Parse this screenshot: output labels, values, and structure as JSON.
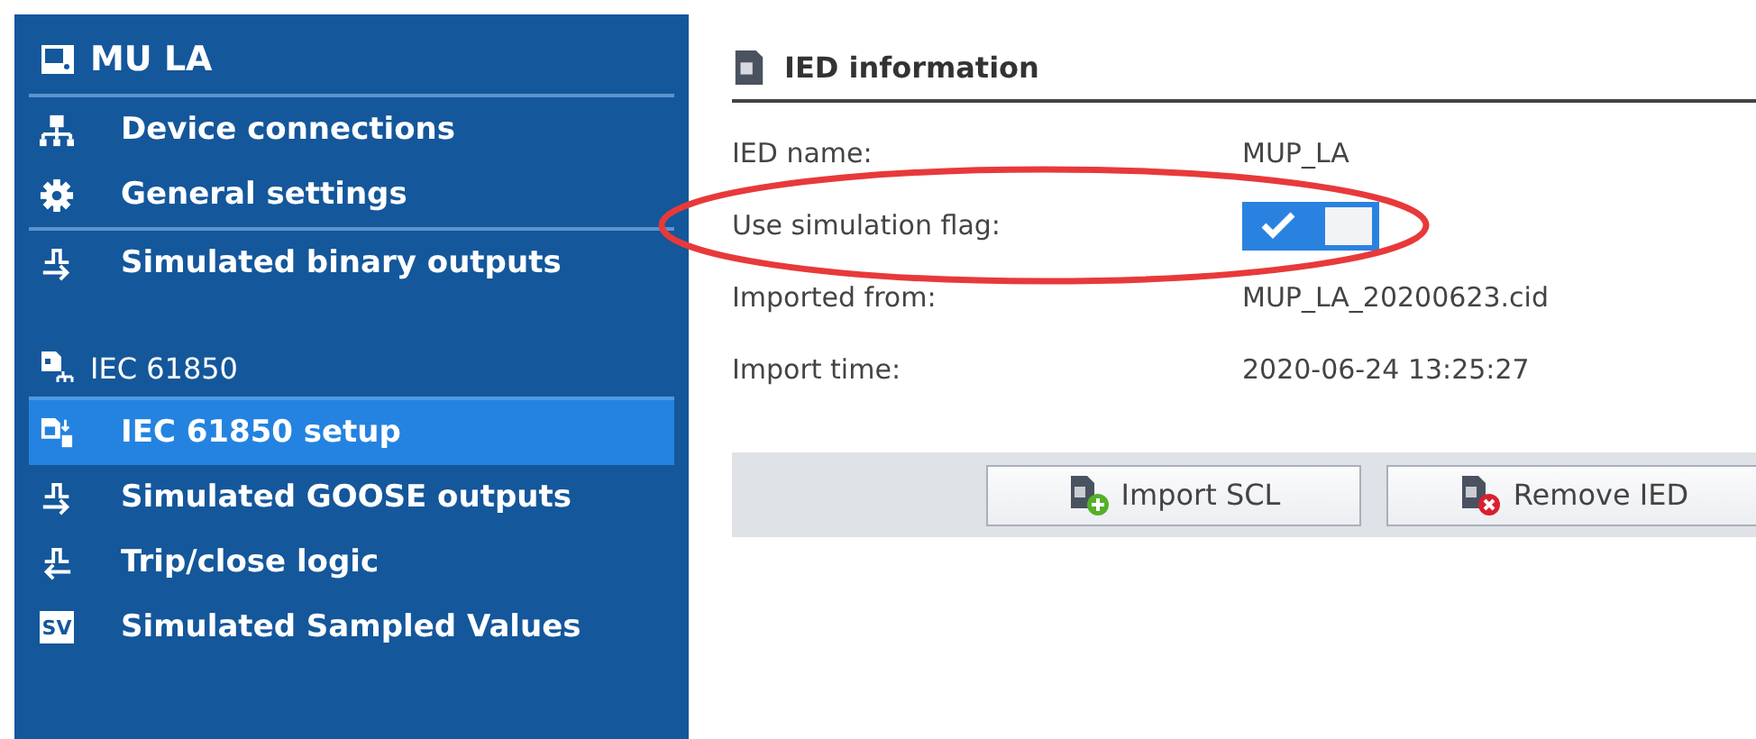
{
  "sidebar": {
    "sections": [
      {
        "title": "MU LA",
        "kind": "device",
        "items": [
          {
            "label": "Device connections",
            "kind": "network",
            "selected": false
          },
          {
            "label": "General settings",
            "kind": "gear",
            "selected": false
          },
          {
            "label": "Simulated binary outputs",
            "kind": "out",
            "selected": false
          }
        ]
      },
      {
        "title": "IEC 61850",
        "kind": "iec",
        "items": [
          {
            "label": "IEC 61850 setup",
            "kind": "setup",
            "selected": true
          },
          {
            "label": "Simulated GOOSE outputs",
            "kind": "out",
            "selected": false
          },
          {
            "label": "Trip/close logic",
            "kind": "in",
            "selected": false
          },
          {
            "label": "Simulated Sampled Values",
            "kind": "sv",
            "icon_text": "SV",
            "selected": false
          }
        ]
      }
    ]
  },
  "panel": {
    "title": "IED information",
    "rows": [
      {
        "label": "IED name:",
        "kind": "text",
        "value": "MUP_LA",
        "highlighted": false
      },
      {
        "label": "Use simulation flag:",
        "kind": "toggle",
        "on": true,
        "highlighted": true
      },
      {
        "label": "Imported from:",
        "kind": "text",
        "value": "MUP_LA_20200623.cid",
        "highlighted": false
      },
      {
        "label": "Import time:",
        "kind": "text",
        "value": "2020-06-24 13:25:27",
        "highlighted": false
      }
    ],
    "buttons": [
      {
        "label": "Import SCL",
        "kind": "add"
      },
      {
        "label": "Remove IED",
        "kind": "remove"
      }
    ]
  }
}
